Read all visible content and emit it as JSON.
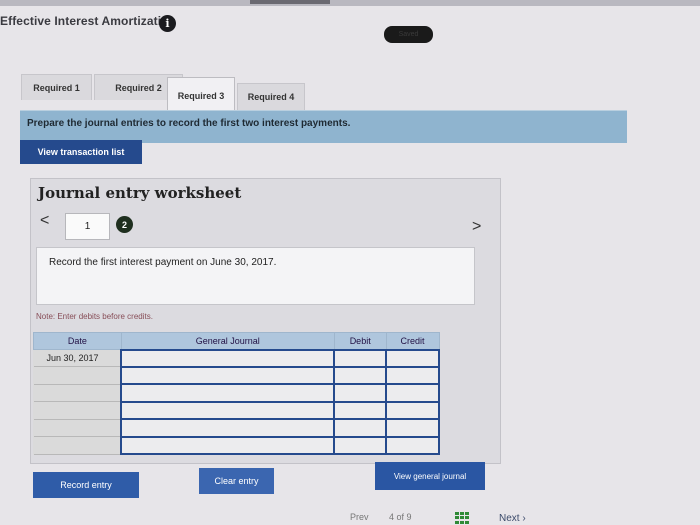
{
  "header": {
    "title": "Effective Interest Amortization",
    "saved": "Saved"
  },
  "tabs": [
    {
      "label": "Required 1"
    },
    {
      "label": "Required 2"
    },
    {
      "label": "Required 3"
    },
    {
      "label": "Required 4"
    }
  ],
  "prompt": "Prepare the journal entries to record the first two interest payments.",
  "view_transaction_list": "View transaction list",
  "worksheet": {
    "title": "Journal entry worksheet",
    "step_current": "1",
    "step_next": "2",
    "prev": "<",
    "next": ">",
    "instruction": "Record the first interest payment on June 30, 2017.",
    "note": "Note: Enter debits before credits.",
    "columns": [
      "Date",
      "General Journal",
      "Debit",
      "Credit"
    ],
    "rows": [
      {
        "date": "Jun 30, 2017"
      },
      {
        "date": ""
      },
      {
        "date": ""
      },
      {
        "date": ""
      },
      {
        "date": ""
      },
      {
        "date": ""
      }
    ]
  },
  "buttons": {
    "record_entry": "Record entry",
    "clear_entry": "Clear entry",
    "view_general_journal": "View general journal"
  },
  "pager": {
    "prev": "Prev",
    "position": "4 of 9",
    "next": "Next"
  },
  "colors": {
    "banner": "#8fb4cf",
    "button_blue": "#254a8d",
    "table_header": "#afc6dd"
  }
}
